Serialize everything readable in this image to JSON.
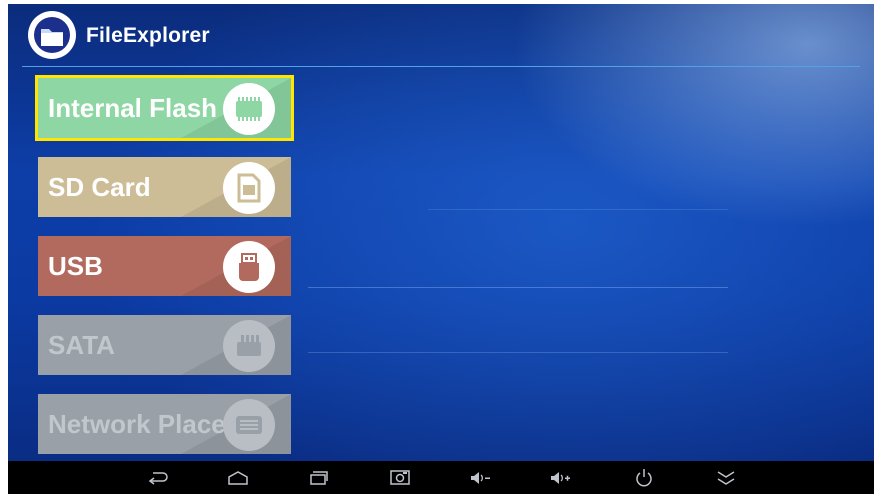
{
  "app": {
    "title": "FileExplorer",
    "icon": "folder-icon",
    "accent": "#4fa3e6"
  },
  "storage_tiles": [
    {
      "label": "Internal Flash",
      "icon": "memory-chip-icon",
      "color": "#8ed6a3",
      "enabled": true,
      "focused": true
    },
    {
      "label": "SD Card",
      "icon": "sd-card-icon",
      "color": "#cdbd97",
      "enabled": true,
      "focused": false
    },
    {
      "label": "USB",
      "icon": "usb-drive-icon",
      "color": "#b26a5e",
      "enabled": true,
      "focused": false
    },
    {
      "label": "SATA",
      "icon": "sata-drive-icon",
      "color": "#9aa0a8",
      "enabled": false,
      "focused": false
    },
    {
      "label": "Network Place",
      "icon": "network-drive-icon",
      "color": "#9aa0a8",
      "enabled": false,
      "focused": false
    }
  ],
  "navigation_bar": [
    {
      "icon": "back-icon"
    },
    {
      "icon": "home-icon"
    },
    {
      "icon": "recent-apps-icon"
    },
    {
      "icon": "screenshot-icon"
    },
    {
      "icon": "volume-down-icon"
    },
    {
      "icon": "volume-up-icon"
    },
    {
      "icon": "power-icon"
    },
    {
      "icon": "collapse-icon"
    }
  ]
}
